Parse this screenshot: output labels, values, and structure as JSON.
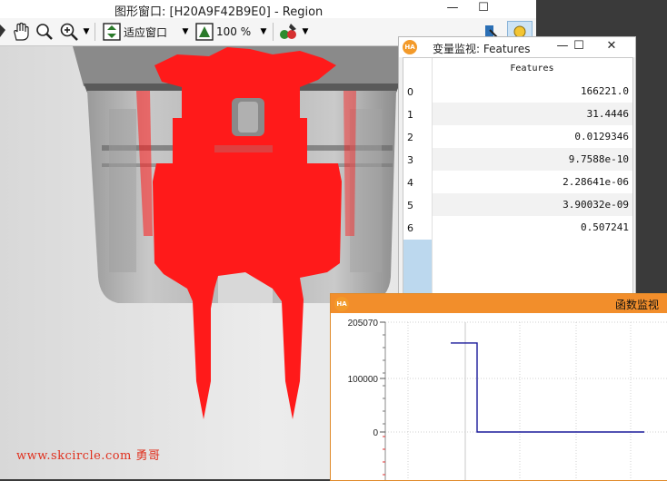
{
  "main_window": {
    "title": "图形窗口: [H20A9F42B9E0] - Region",
    "buttons": {
      "minimize": "—",
      "maximize": "☐"
    },
    "toolbar": {
      "zoom_mode_label": "适应窗口",
      "zoom_percent_label": "100 %"
    }
  },
  "watermark": "www.skcircle.com 勇哥",
  "variable_monitor": {
    "title": "变量监视: Features",
    "icon_text": "HA",
    "buttons": {
      "minimize": "—",
      "maximize": "☐",
      "close": "✕"
    },
    "column_header": "Features",
    "rows": [
      {
        "index": "0",
        "value": "166221.0"
      },
      {
        "index": "1",
        "value": "31.4446"
      },
      {
        "index": "2",
        "value": "0.0129346"
      },
      {
        "index": "3",
        "value": "9.7588e-10"
      },
      {
        "index": "4",
        "value": "2.28641e-06"
      },
      {
        "index": "5",
        "value": "3.90032e-09"
      },
      {
        "index": "6",
        "value": "0.507241"
      }
    ]
  },
  "function_monitor": {
    "title": "函数监视",
    "icon_text": "HA",
    "y_tick_labels": [
      "205070",
      "100000",
      "0"
    ],
    "chart_data": {
      "type": "line",
      "ylim": [
        -90000,
        205070
      ],
      "series": [
        {
          "color": "#1a1a9a",
          "points": [
            [
              0,
              166221
            ],
            [
              29,
              166221
            ],
            [
              29,
              0
            ],
            [
              213,
              0
            ]
          ]
        }
      ],
      "grid": true
    }
  }
}
